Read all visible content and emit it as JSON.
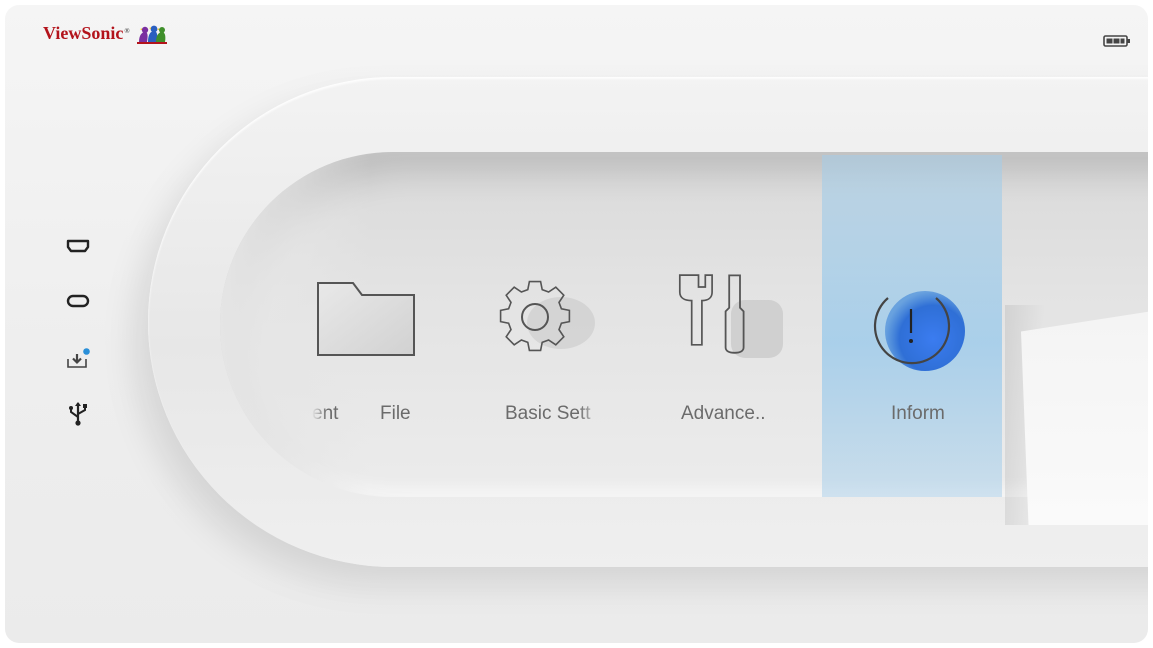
{
  "brand": {
    "name": "ViewSonic",
    "reg": "®"
  },
  "status": {
    "battery_icon": "battery-icon"
  },
  "sources": [
    {
      "icon": "hdmi-port-icon"
    },
    {
      "icon": "usb-c-port-icon"
    },
    {
      "icon": "download-tray-icon",
      "badge_color": "#2a8fd8"
    },
    {
      "icon": "usb-icon"
    }
  ],
  "menu": {
    "items": [
      {
        "label": "ent",
        "icon": ""
      },
      {
        "label": "File",
        "icon": "folder-icon"
      },
      {
        "label": "Basic Sett",
        "icon": "gear-icon"
      },
      {
        "label": "Advance..",
        "icon": "tools-icon"
      },
      {
        "label": "Inform",
        "icon": "info-icon",
        "selected": true
      }
    ],
    "accent_color": "#2f6fd6",
    "highlight_color": "#a9d0ee"
  }
}
